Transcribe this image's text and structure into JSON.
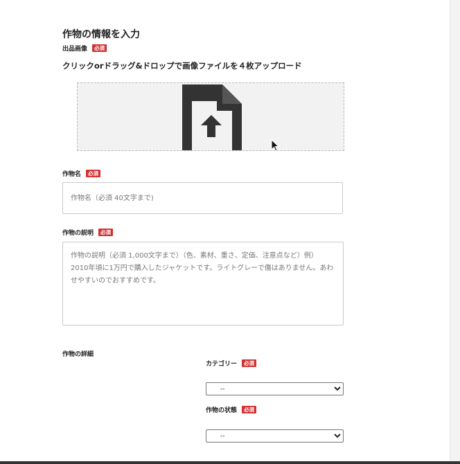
{
  "form": {
    "section_title": "作物の情報を入力",
    "required_badge": "必須",
    "image_upload": {
      "label": "出品画像",
      "instruction": "クリックorドラッグ&ドロップで画像ファイルを４枚アップロード",
      "icon": "file-upload-icon"
    },
    "crop_name": {
      "label": "作物名",
      "placeholder": "作物名（必須 40文字まで)"
    },
    "crop_description": {
      "label": "作物の説明",
      "placeholder": "作物の説明（必須 1,000文字まで）（色、素材、重さ、定価、注意点など）例）2010年頃に1万円で購入したジャケットです。ライトグレーで傷はありません。あわせやすいのでおすすめです。"
    },
    "details": {
      "label": "作物の詳細",
      "category": {
        "label": "カテゴリー",
        "selected": "--"
      },
      "condition": {
        "label": "作物の状態",
        "selected": "--"
      }
    }
  },
  "colors": {
    "badge": "#d32f2f",
    "dropzone_bg": "#f2f2f2",
    "icon": "#333333"
  }
}
